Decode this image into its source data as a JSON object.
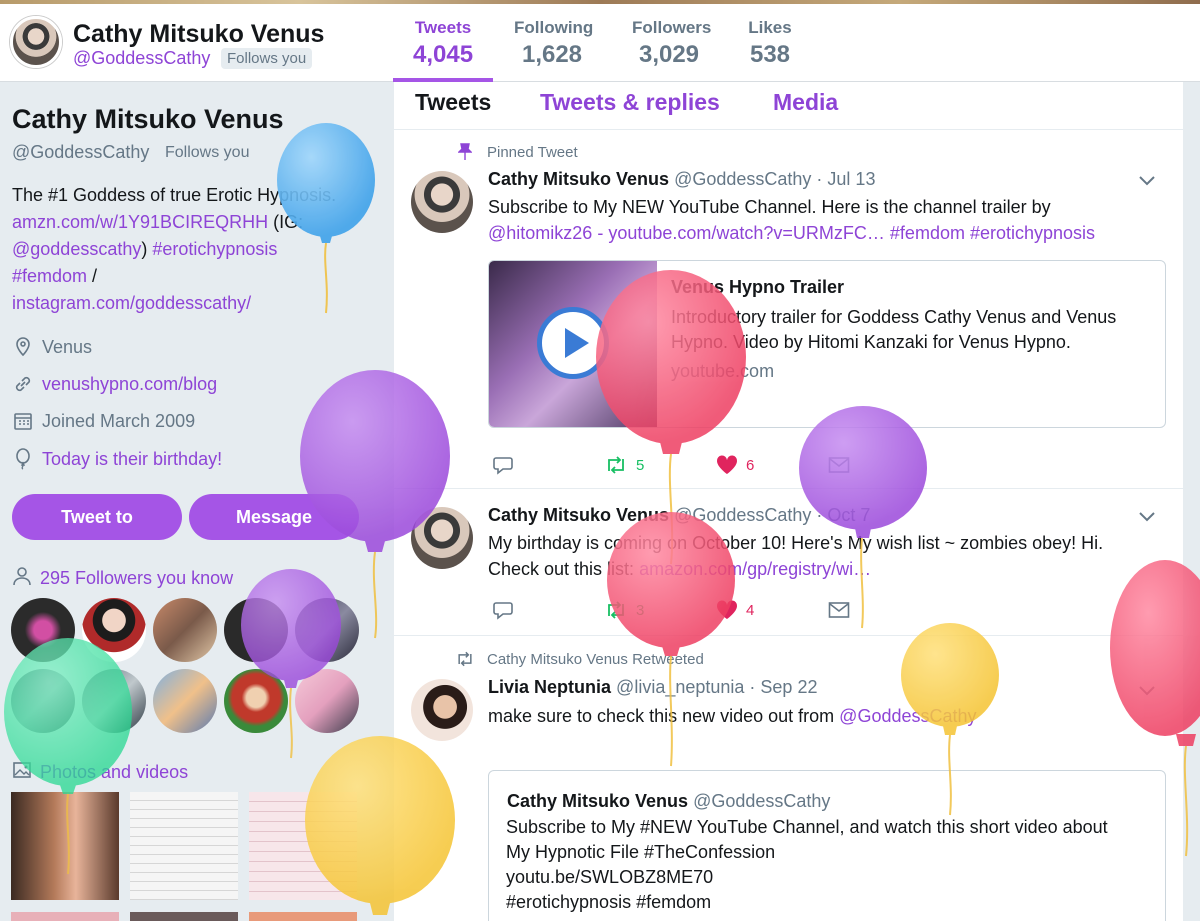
{
  "header": {
    "name": "Cathy Mitsuko Venus",
    "handle": "@GoddessCathy",
    "follows_you": "Follows you",
    "stats": [
      {
        "label": "Tweets",
        "value": "4,045"
      },
      {
        "label": "Following",
        "value": "1,628"
      },
      {
        "label": "Followers",
        "value": "3,029"
      },
      {
        "label": "Likes",
        "value": "538"
      }
    ]
  },
  "profile": {
    "name": "Cathy Mitsuko Venus",
    "handle": "@GoddessCathy",
    "follows_you": "Follows you",
    "bio_text1": "The #1 Goddess of true Erotic Hypnosis.",
    "bio_link1": "amzn.com/w/1Y91BCIREQRHH",
    "bio_text2": " (IG:",
    "bio_link2": "@goddesscathy",
    "bio_text3": ") ",
    "bio_link3": "#erotichypnosis",
    "bio_link4": "#femdom",
    "bio_text4": " /",
    "bio_link5": "instagram.com/goddesscathy/",
    "location": "Venus",
    "website": "venushypno.com/blog",
    "joined": "Joined March 2009",
    "birthday": "Today is their birthday!",
    "tweet_to": "Tweet to",
    "message": "Message",
    "followers_you_know": "295 Followers you know",
    "photos_videos": "Photos and videos"
  },
  "tabs": [
    "Tweets",
    "Tweets & replies",
    "Media"
  ],
  "tweets": [
    {
      "context": "Pinned Tweet",
      "name": "Cathy Mitsuko Venus",
      "handle": "@GoddessCathy",
      "date": "· Jul 13",
      "text": "Subscribe to My NEW YouTube Channel. Here is the channel trailer by",
      "link_mention": "@hitomikz26",
      "sep": " - ",
      "link_url": "youtube.com/watch?v=URMzFC…",
      "link_tag1": "#femdom",
      "link_tag2": "#erotichypnosis",
      "card": {
        "title": "Venus Hypno Trailer",
        "desc": "Introductory trailer for Goddess Cathy Venus and Venus Hypno. Video by Hitomi Kanzaki for Venus Hypno.",
        "host": "youtube.com"
      },
      "retweets": "5",
      "likes": "6"
    },
    {
      "name": "Cathy Mitsuko Venus",
      "handle": "@GoddessCathy",
      "date": "· Oct 7",
      "text1": "My birthday is coming on October 10! Here's My wish list ~ zombies obey! Hi.",
      "text2": "Check out this list: ",
      "link_url": "amazon.com/gp/registry/wi…",
      "retweets": "3",
      "likes": "4"
    },
    {
      "context": "Cathy Mitsuko Venus Retweeted",
      "name": "Livia Neptunia",
      "handle": "@livia_neptunia",
      "date": "· Sep 22",
      "text": "make sure to check this new video out from ",
      "link_mention": "@GoddessCathy",
      "quote": {
        "name": "Cathy Mitsuko Venus",
        "handle": "@GoddessCathy",
        "line1": "Subscribe to My #NEW YouTube Channel, and watch this short video about",
        "line2": "My Hypnotic File #TheConfession",
        "line3": "youtu.be/SWLOBZ8ME70",
        "line4": " #erotichypnosis #femdom"
      }
    }
  ],
  "colors": {
    "accent": "#8e44d6",
    "button": "#a555e6",
    "like": "#e0245e",
    "retweet": "#17bf63",
    "balloon_blue": "#56b3ee",
    "balloon_purple": "#a55be0",
    "balloon_red": "#f0506e",
    "balloon_yellow": "#f7ce46",
    "balloon_green": "#3fe0a0"
  }
}
